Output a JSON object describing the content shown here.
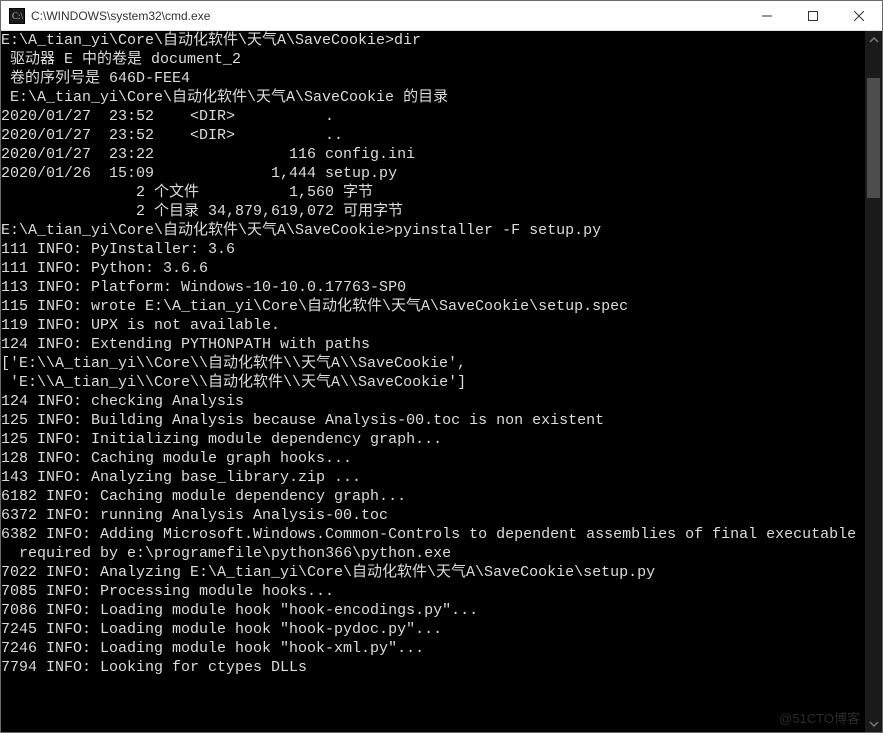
{
  "window": {
    "title": "C:\\WINDOWS\\system32\\cmd.exe"
  },
  "terminal": {
    "lines": [
      "",
      "E:\\A_tian_yi\\Core\\自动化软件\\天气A\\SaveCookie>dir",
      " 驱动器 E 中的卷是 document_2",
      " 卷的序列号是 646D-FEE4",
      "",
      " E:\\A_tian_yi\\Core\\自动化软件\\天气A\\SaveCookie 的目录",
      "",
      "2020/01/27  23:52    <DIR>          .",
      "2020/01/27  23:52    <DIR>          ..",
      "2020/01/27  23:22               116 config.ini",
      "2020/01/26  15:09             1,444 setup.py",
      "               2 个文件          1,560 字节",
      "               2 个目录 34,879,619,072 可用字节",
      "",
      "E:\\A_tian_yi\\Core\\自动化软件\\天气A\\SaveCookie>pyinstaller -F setup.py",
      "111 INFO: PyInstaller: 3.6",
      "111 INFO: Python: 3.6.6",
      "113 INFO: Platform: Windows-10-10.0.17763-SP0",
      "115 INFO: wrote E:\\A_tian_yi\\Core\\自动化软件\\天气A\\SaveCookie\\setup.spec",
      "119 INFO: UPX is not available.",
      "124 INFO: Extending PYTHONPATH with paths",
      "['E:\\\\A_tian_yi\\\\Core\\\\自动化软件\\\\天气A\\\\SaveCookie',",
      " 'E:\\\\A_tian_yi\\\\Core\\\\自动化软件\\\\天气A\\\\SaveCookie']",
      "124 INFO: checking Analysis",
      "125 INFO: Building Analysis because Analysis-00.toc is non existent",
      "125 INFO: Initializing module dependency graph...",
      "128 INFO: Caching module graph hooks...",
      "143 INFO: Analyzing base_library.zip ...",
      "6182 INFO: Caching module dependency graph...",
      "6372 INFO: running Analysis Analysis-00.toc",
      "6382 INFO: Adding Microsoft.Windows.Common-Controls to dependent assemblies of final executable",
      "  required by e:\\programefile\\python366\\python.exe",
      "7022 INFO: Analyzing E:\\A_tian_yi\\Core\\自动化软件\\天气A\\SaveCookie\\setup.py",
      "7085 INFO: Processing module hooks...",
      "7086 INFO: Loading module hook \"hook-encodings.py\"...",
      "7245 INFO: Loading module hook \"hook-pydoc.py\"...",
      "7246 INFO: Loading module hook \"hook-xml.py\"...",
      "7794 INFO: Looking for ctypes DLLs"
    ]
  },
  "watermark": "@51CTO博客"
}
